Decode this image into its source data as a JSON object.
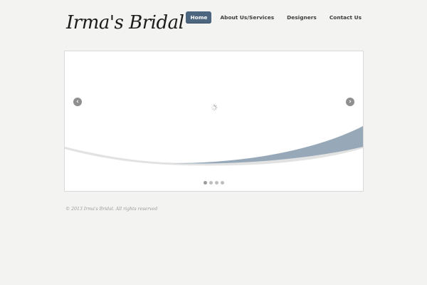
{
  "header": {
    "logo_text": "Irma's Bridal"
  },
  "nav": {
    "items": [
      {
        "label": "Home",
        "active": true
      },
      {
        "label": "About Us/Services",
        "active": false
      },
      {
        "label": "Designers",
        "active": false
      },
      {
        "label": "Contact Us",
        "active": false
      }
    ]
  },
  "slider": {
    "prev_icon": "chevron-left-icon",
    "next_icon": "chevron-right-icon",
    "loader_icon": "spinner-icon",
    "slide_count": 4,
    "active_slide": 1,
    "accent_color": "#8fa2b2"
  },
  "footer": {
    "copyright": "© 2013 Irma's Bridal. All rights reserved"
  }
}
